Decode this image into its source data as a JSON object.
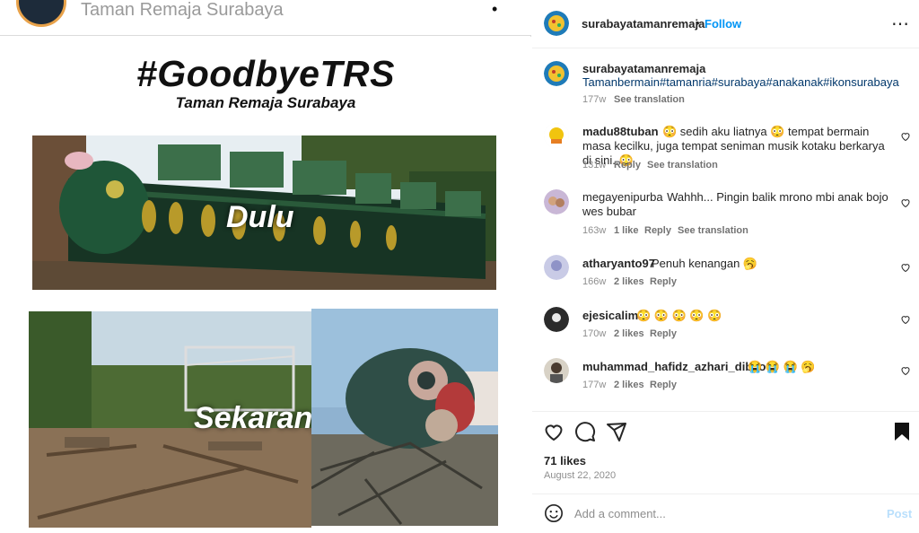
{
  "header": {
    "account": "Taman Remaja Surabaya"
  },
  "image": {
    "hashtag": "#GoodbyeTRS",
    "subtitle": "Taman Remaja Surabaya",
    "label_before": "Dulu",
    "label_after": "Sekarang"
  },
  "post": {
    "username": "surabayatamanremaja",
    "follow": "Follow",
    "separator": "•"
  },
  "caption": {
    "username": "surabayatamanremaja",
    "text": "Tamanbermain#tamanria#surabaya#anakanak#ikonsurabaya",
    "time": "177w",
    "translate": "See translation"
  },
  "comments": [
    {
      "username": "madu88tuban",
      "text": "😳 sedih aku liatnya 😳 tempat bermain masa kecilku, juga tempat seniman musik kotaku berkarya di sini..😳",
      "time": "131w",
      "likes": "",
      "reply": "Reply",
      "translate": "See translation"
    },
    {
      "username": "megayenipurba",
      "text": "Wahhh... Pingin balik mrono mbi anak bojo wes bubar",
      "time": "163w",
      "likes": "1 like",
      "reply": "Reply",
      "translate": "See translation"
    },
    {
      "username": "atharyanto97",
      "text": "Penuh kenangan 🥱",
      "time": "166w",
      "likes": "2 likes",
      "reply": "Reply",
      "translate": ""
    },
    {
      "username": "ejesicalim",
      "text": "😳 😳 😳 😳 😳",
      "time": "170w",
      "likes": "2 likes",
      "reply": "Reply",
      "translate": ""
    },
    {
      "username": "muhammad_hafidz_azhari_dibyo",
      "text": "😭 😭 😭 🥱",
      "time": "177w",
      "likes": "2 likes",
      "reply": "Reply",
      "translate": ""
    }
  ],
  "stats": {
    "likes": "71 likes",
    "date": "August 22, 2020"
  },
  "add_comment": {
    "placeholder": "Add a comment...",
    "post": "Post"
  },
  "icons": {
    "more": "more-icon",
    "like": "heart-icon",
    "comment": "comment-icon",
    "share": "send-icon",
    "save": "bookmark-icon",
    "emoji": "emoji-icon"
  },
  "colors": {
    "accent": "#0095f6",
    "text": "#262626",
    "muted": "#8e8e8e"
  }
}
